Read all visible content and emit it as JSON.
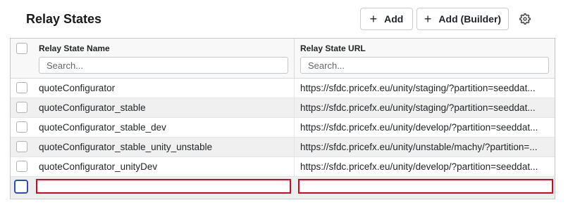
{
  "page": {
    "title": "Relay States"
  },
  "toolbar": {
    "add_label": "Add",
    "add_builder_label": "Add (Builder)",
    "add_icon": "plus-icon",
    "settings_icon": "gear-icon"
  },
  "grid": {
    "columns": [
      {
        "label": "Relay State Name",
        "filter_placeholder": "Search..."
      },
      {
        "label": "Relay State URL",
        "filter_placeholder": "Search..."
      }
    ],
    "rows": [
      {
        "name": "quoteConfigurator",
        "url": "https://sfdc.pricefx.eu/unity/staging/?partition=seeddat..."
      },
      {
        "name": "quoteConfigurator_stable",
        "url": "https://sfdc.pricefx.eu/unity/staging/?partition=seeddat..."
      },
      {
        "name": "quoteConfigurator_stable_dev",
        "url": "https://sfdc.pricefx.eu/unity/develop/?partition=seeddat..."
      },
      {
        "name": "quoteConfigurator_stable_unity_unstable",
        "url": "https://sfdc.pricefx.eu/unity/unstable/machy/?partition=..."
      },
      {
        "name": "quoteConfigurator_unityDev",
        "url": "https://sfdc.pricefx.eu/unity/develop/?partition=seeddat..."
      }
    ],
    "new_row": {
      "name": "",
      "url": ""
    }
  },
  "colors": {
    "accent": "#2f4fa3",
    "error_border": "#e0001a",
    "alt_row": "#f0f0f0"
  }
}
